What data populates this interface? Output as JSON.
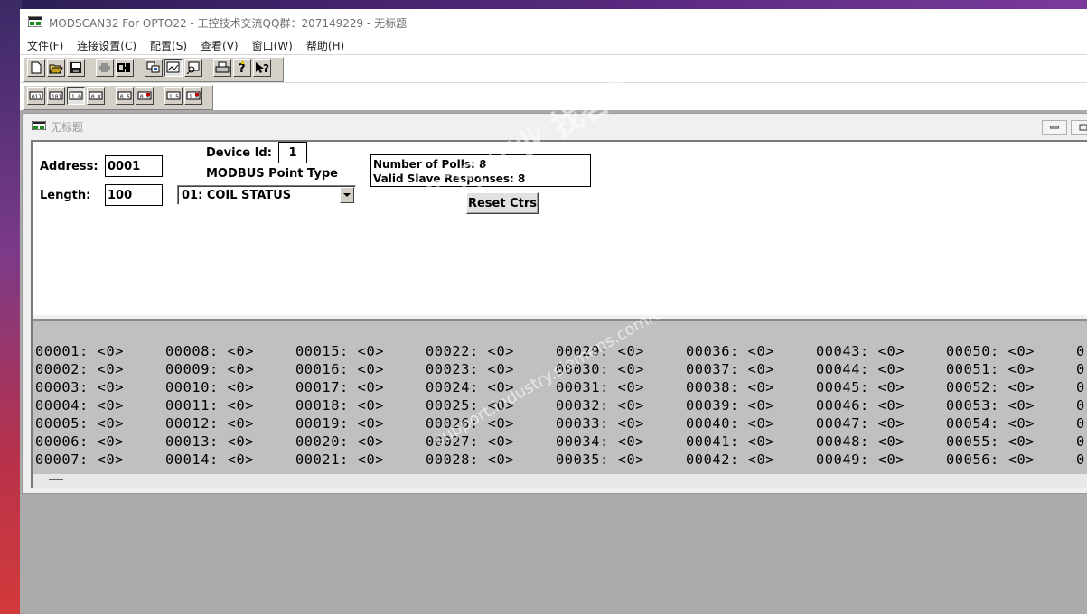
{
  "window": {
    "title": "MODSCAN32 For OPTO22 - 工控技术交流QQ群：207149229 - 无标题"
  },
  "menu": [
    {
      "label": "文件(F)"
    },
    {
      "label": "连接设置(C)"
    },
    {
      "label": "配置(S)"
    },
    {
      "label": "查看(V)"
    },
    {
      "label": "窗口(W)"
    },
    {
      "label": "帮助(H)"
    }
  ],
  "toolbar1": {
    "icons": [
      "new-file-icon",
      "open-folder-icon",
      "save-icon",
      "connect-icon",
      "disconnect-icon",
      "display-options-icon",
      "display-mode-icon",
      "text-capture-icon",
      "print-icon",
      "help-icon",
      "context-help-icon"
    ]
  },
  "toolbar2": {
    "icons": [
      "coil-01-icon",
      "input-02-icon",
      "register-03-icon",
      "register-04-icon",
      "write-05-icon",
      "write-06-icon",
      "write-15-icon",
      "write-16-icon"
    ]
  },
  "child": {
    "title": "无标题",
    "address_label": "Address:",
    "address_value": "0001",
    "length_label": "Length:",
    "length_value": "100",
    "device_id_label": "Device Id:",
    "device_id_value": "1",
    "point_type_label": "MODBUS Point Type",
    "point_type_value": "01: COIL STATUS",
    "polls_text": "Number of Polls: 8",
    "responses_text": "Valid Slave Responses: 8",
    "reset_label": "Reset Ctrs"
  },
  "data_rows": [
    [
      "00001: <0>",
      "00008: <0>",
      "00015: <0>",
      "00022: <0>",
      "00029: <0>",
      "00036: <0>",
      "00043: <0>",
      "00050: <0>",
      "0"
    ],
    [
      "00002: <0>",
      "00009: <0>",
      "00016: <0>",
      "00023: <0>",
      "00030: <0>",
      "00037: <0>",
      "00044: <0>",
      "00051: <0>",
      "0"
    ],
    [
      "00003: <0>",
      "00010: <0>",
      "00017: <0>",
      "00024: <0>",
      "00031: <0>",
      "00038: <0>",
      "00045: <0>",
      "00052: <0>",
      "0"
    ],
    [
      "00004: <0>",
      "00011: <0>",
      "00018: <0>",
      "00025: <0>",
      "00032: <0>",
      "00039: <0>",
      "00046: <0>",
      "00053: <0>",
      "0"
    ],
    [
      "00005: <0>",
      "00012: <0>",
      "00019: <0>",
      "00026: <0>",
      "00033: <0>",
      "00040: <0>",
      "00047: <0>",
      "00054: <0>",
      "0"
    ],
    [
      "00006: <0>",
      "00013: <0>",
      "00020: <0>",
      "00027: <0>",
      "00034: <0>",
      "00041: <0>",
      "00048: <0>",
      "00055: <0>",
      "0"
    ],
    [
      "00007: <0>",
      "00014: <0>",
      "00021: <0>",
      "00028: <0>",
      "00035: <0>",
      "00042: <0>",
      "00049: <0>",
      "00056: <0>",
      "0"
    ]
  ],
  "watermark": {
    "line1": "西门子工业   找答案",
    "line2": "support.industry.siemens.com/cs"
  }
}
